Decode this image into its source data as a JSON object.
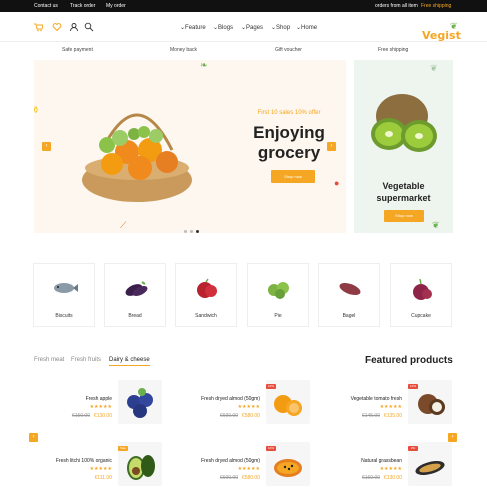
{
  "topbar": {
    "links": [
      "Contact us",
      "Track order",
      "My order"
    ],
    "promo_prefix": "orders from all item",
    "promo_highlight": "Free shipping"
  },
  "header": {
    "nav": [
      "Feature",
      "Blogs",
      "Pages",
      "Shop",
      "Home"
    ],
    "logo": "Vegist"
  },
  "features": [
    "Safe payment",
    "Money back",
    "Gift voucher",
    "Free shipping"
  ],
  "hero": {
    "kicker": "First 10 sales 10% offer",
    "title_line1": "Enjoying",
    "title_line2": "grocery",
    "cta": "Shop now"
  },
  "side_banner": {
    "title_line1": "Vegetable",
    "title_line2": "supermarket",
    "cta": "Shop now"
  },
  "categories": [
    "Biscuits",
    "Bread",
    "Sandwich",
    "Pie",
    "Bagel",
    "Cupcake"
  ],
  "tabs": [
    "Fresh meat",
    "Fresh fruits",
    "Dairy & cheese"
  ],
  "featured_title": "Featured products",
  "products": [
    {
      "name": "Fresh apple",
      "old": "€150.00",
      "new": "€130.00",
      "badge": ""
    },
    {
      "name": "Fresh dryed almod (50gm)",
      "old": "€690.00",
      "new": "€580.00",
      "badge": "10%"
    },
    {
      "name": "Vegetable tomato fresh",
      "old": "€145.00",
      "new": "€135.00",
      "badge": "10%"
    },
    {
      "name": "Fresh litchi 100% organic",
      "old": "",
      "new": "€111.00",
      "badge": "Sale"
    },
    {
      "name": "Fresh dryed almod (50gm)",
      "old": "€690.00",
      "new": "€580.00",
      "badge": "10%"
    },
    {
      "name": "Natural grassbean",
      "old": "€160.00",
      "new": "€130.00",
      "badge": "2%"
    }
  ],
  "colors": {
    "accent": "#f5a623",
    "dark": "#111111",
    "sale": "#e74c3c"
  }
}
